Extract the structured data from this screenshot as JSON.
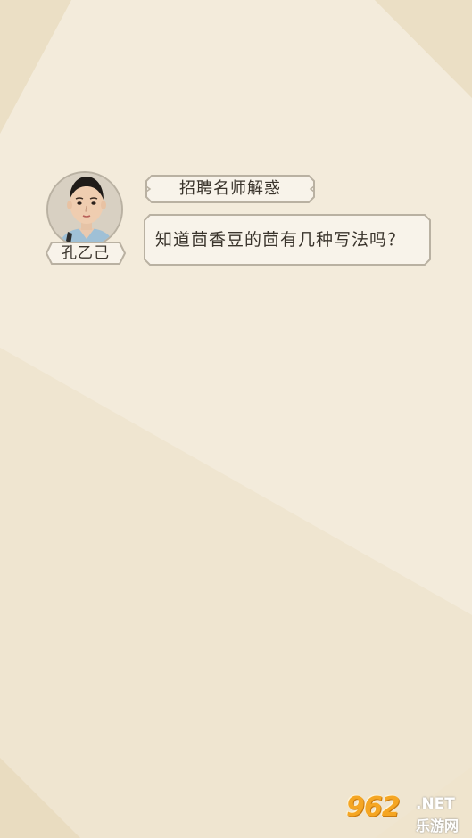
{
  "colors": {
    "background": "#f0e6d1",
    "background_light": "#f4ecdc",
    "panel_border": "#b9b1a2",
    "panel_fill": "#f8f3ea",
    "text": "#3a342c",
    "watermark_orange": "#f5a623"
  },
  "character": {
    "name": "孔乙己",
    "avatar_icon": "portrait-icon"
  },
  "dialog": {
    "title": "招聘名师解惑",
    "question": "知道茴香豆的茴有几种写法吗？"
  },
  "watermark": {
    "logo": "962",
    "net": ".NET",
    "subtitle": "乐游网"
  }
}
